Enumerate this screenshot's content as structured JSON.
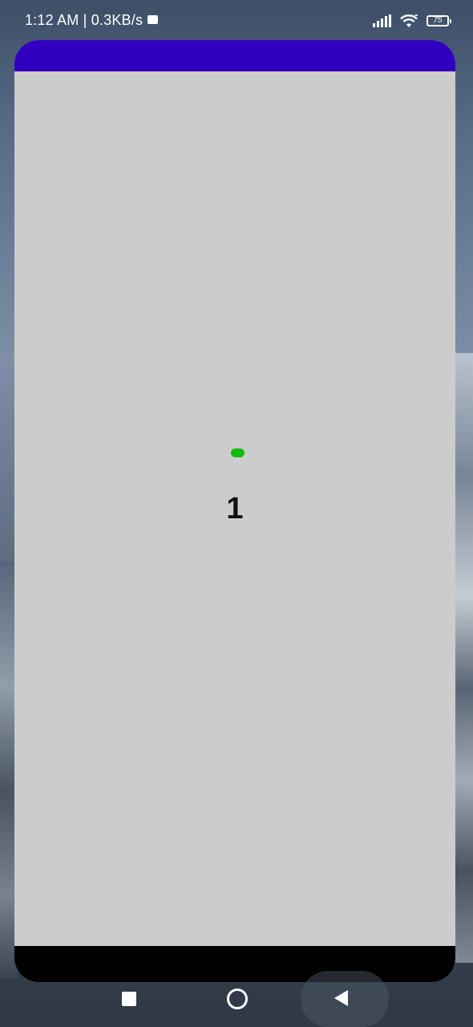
{
  "status_bar": {
    "time": "1:12 AM | 0.3KB/s",
    "battery": "75",
    "icons": [
      "video-camera-icon",
      "signal-icon",
      "wifi-icon",
      "battery-icon"
    ]
  },
  "app": {
    "topbar_color": "#3100bf",
    "background_color": "#cccccc",
    "indicator_color": "#11bb11",
    "counter_value": "1"
  },
  "nav_bar": {
    "buttons": [
      "recent-apps-button",
      "home-button",
      "back-button"
    ]
  }
}
